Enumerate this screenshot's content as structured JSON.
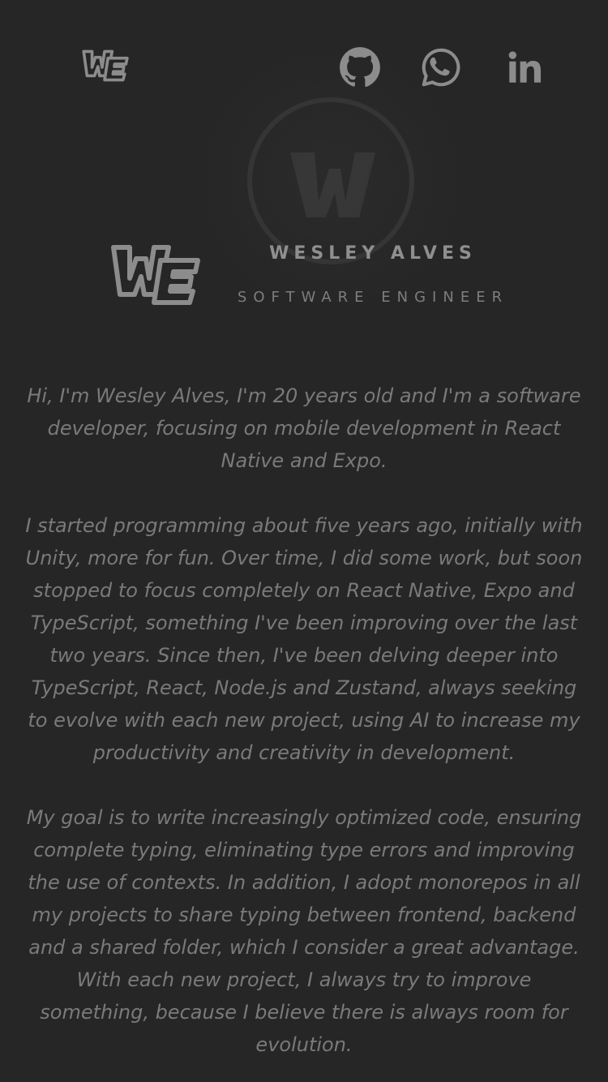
{
  "header": {
    "logo_text": "WE",
    "social": [
      {
        "name": "GitHub",
        "icon": "github-icon"
      },
      {
        "name": "WhatsApp",
        "icon": "whatsapp-icon"
      },
      {
        "name": "LinkedIn",
        "icon": "linkedin-icon"
      }
    ]
  },
  "hero": {
    "logo_text": "WE",
    "name": "WESLEY ALVES",
    "role": "SOFTWARE ENGINEER"
  },
  "bio": {
    "paragraphs": [
      "Hi, I'm Wesley Alves, I'm 20 years old and I'm a software developer, focusing on mobile development in React Native and Expo.",
      "I started programming about five years ago, initially with Unity, more for fun. Over time, I did some work, but soon stopped to focus completely on React Native, Expo and TypeScript, something I've been improving over the last two years. Since then, I've been delving deeper into TypeScript, React, Node.js and Zustand, always seeking to evolve with each new project, using AI to increase my productivity and creativity in development.",
      "My goal is to write increasingly optimized code, ensuring complete typing, eliminating type errors and improving the use of contexts. In addition, I adopt monorepos in all my projects to share typing between frontend, backend and a shared folder, which I consider a great advantage. With each new project, I always try to improve something, because I believe there is always room for evolution."
    ]
  },
  "colors": {
    "background": "#262626",
    "icon": "#8c8c8c",
    "name": "#8f8f8f",
    "role": "#7d7d7d",
    "text": "#7a7a7a"
  }
}
